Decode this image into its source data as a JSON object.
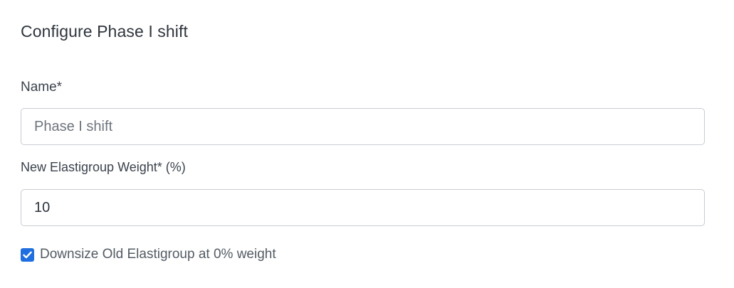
{
  "dialog": {
    "title": "Configure Phase I shift"
  },
  "form": {
    "name": {
      "label": "Name*",
      "value": "Phase I shift"
    },
    "weight": {
      "label": "New Elastigroup Weight* (%)",
      "value": "10"
    },
    "downsize": {
      "label": "Downsize Old Elastigroup at 0% weight",
      "checked": true
    }
  },
  "colors": {
    "accent": "#1f6fe0",
    "border": "#c9ccd2"
  }
}
